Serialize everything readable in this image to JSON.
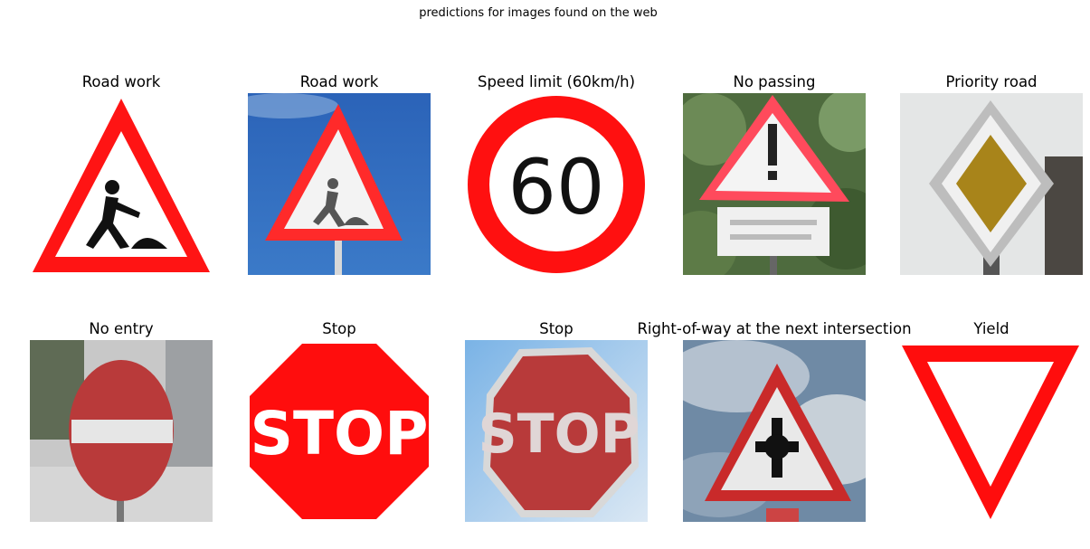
{
  "figure": {
    "suptitle": "predictions for images found on the web"
  },
  "panels": [
    {
      "title": "Road work",
      "sign": "road-work-sign"
    },
    {
      "title": "Road work",
      "sign": "road-work-sign"
    },
    {
      "title": "Speed limit (60km/h)",
      "sign": "speed-limit-sign",
      "sign_text": "60"
    },
    {
      "title": "No passing",
      "sign": "warning-sign-with-exclamation"
    },
    {
      "title": "Priority road",
      "sign": "priority-road-sign"
    },
    {
      "title": "No entry",
      "sign": "no-entry-sign"
    },
    {
      "title": "Stop",
      "sign": "stop-sign",
      "sign_text": "STOP"
    },
    {
      "title": "Stop",
      "sign": "stop-sign",
      "sign_text": "STOP"
    },
    {
      "title": "Right-of-way at the next intersection",
      "sign": "right-of-way-sign"
    },
    {
      "title": "Yield",
      "sign": "yield-sign"
    }
  ],
  "colors": {
    "sign_red": "#ff1a1a",
    "sky_blue": "#2f6fc0",
    "priority_yellow": "#b38f1e"
  }
}
